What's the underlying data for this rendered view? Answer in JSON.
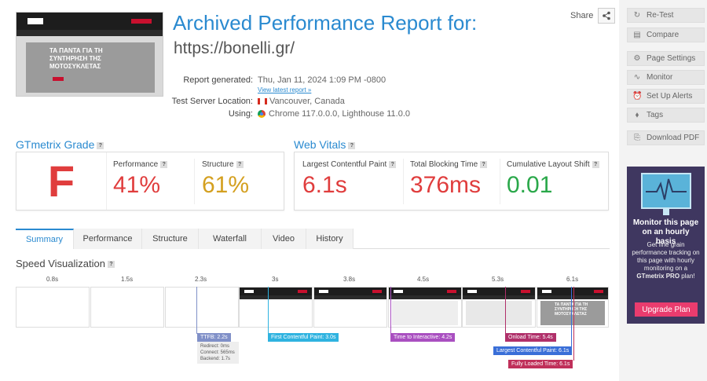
{
  "header": {
    "title": "Archived Performance Report for:",
    "url": "https://bonelli.gr/",
    "share_label": "Share"
  },
  "thumbnail": {
    "hero_text": "ΤΑ ΠΑΝΤΑ ΓΙΑ ΤΗ ΣΥΝΤΗΡΗΣΗ ΤΗΣ ΜΟΤΟΣΥΚΛΕΤΑΣ"
  },
  "meta": {
    "generated_label": "Report generated:",
    "generated_value": "Thu, Jan 11, 2024 1:09 PM -0800",
    "latest_link": "View latest report »",
    "location_label": "Test Server Location:",
    "location_value": "Vancouver, Canada",
    "using_label": "Using:",
    "using_value": "Chrome 117.0.0.0, Lighthouse 11.0.0"
  },
  "grade": {
    "section_title": "GTmetrix Grade",
    "letter": "F",
    "performance_label": "Performance",
    "performance_value": "41%",
    "structure_label": "Structure",
    "structure_value": "61%",
    "colors": {
      "grade": "#e03d3d",
      "performance": "#e03d3d",
      "structure": "#d4a020"
    }
  },
  "vitals": {
    "section_title": "Web Vitals",
    "lcp_label": "Largest Contentful Paint",
    "lcp_value": "6.1s",
    "tbt_label": "Total Blocking Time",
    "tbt_value": "376ms",
    "cls_label": "Cumulative Layout Shift",
    "cls_value": "0.01",
    "colors": {
      "lcp": "#e03d3d",
      "tbt": "#e03d3d",
      "cls": "#2aa84a"
    }
  },
  "tabs": [
    {
      "label": "Summary",
      "active": true
    },
    {
      "label": "Performance"
    },
    {
      "label": "Structure"
    },
    {
      "label": "Waterfall"
    },
    {
      "label": "Video"
    },
    {
      "label": "History"
    }
  ],
  "speed": {
    "title": "Speed Visualization",
    "ticks": [
      "0.8s",
      "1.5s",
      "2.3s",
      "3s",
      "3.8s",
      "4.5s",
      "5.3s",
      "6.1s"
    ],
    "markers": {
      "ttfb": "TTFB: 2.2s",
      "redirect": "Redirect: 0ms",
      "connect": "Connect: 565ms",
      "backend": "Backend: 1.7s",
      "fcp": "First Contentful Paint: 3.0s",
      "tti": "Time to Interactive: 4.2s",
      "onload": "Onload Time: 5.4s",
      "lcp": "Largest Contentful Paint: 6.1s",
      "fully_loaded": "Fully Loaded Time: 6.1s"
    },
    "marker_colors": {
      "ttfb": "#8090c8",
      "fcp": "#2fb3e0",
      "tti": "#a94fc0",
      "onload": "#b0306a",
      "lcp": "#3a6fd8",
      "fully_loaded": "#c0305a"
    }
  },
  "sidebar": {
    "retest": "Re-Test",
    "compare": "Compare",
    "page_settings": "Page Settings",
    "monitor": "Monitor",
    "alerts": "Set Up Alerts",
    "tags": "Tags",
    "download_pdf": "Download PDF"
  },
  "promo": {
    "title": "Monitor this page on an hourly basis",
    "text_1": "Get fine grain performance tracking on this page with hourly monitoring on a",
    "brand": "GTmetrix PRO",
    "text_2": "plan!",
    "button": "Upgrade Plan"
  }
}
